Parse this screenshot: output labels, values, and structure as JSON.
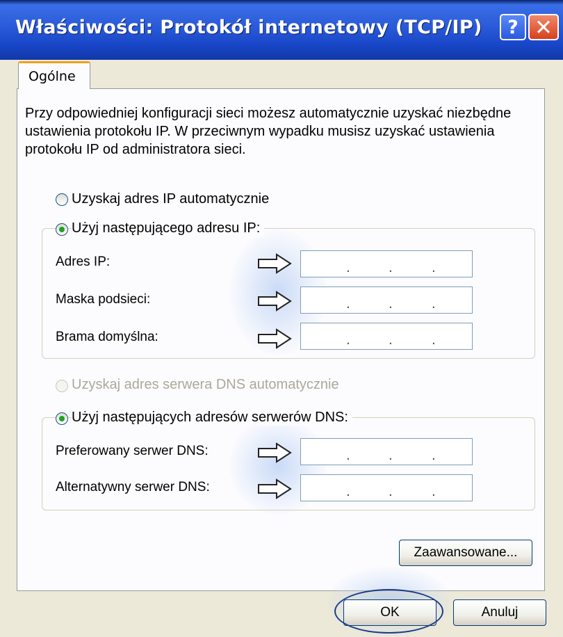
{
  "window": {
    "title": "Właściwości: Protokół internetowy (TCP/IP)",
    "help_glyph": "?",
    "close_glyph": "✕"
  },
  "tabs": [
    {
      "label": "Ogólne",
      "selected": true
    }
  ],
  "description": "Przy odpowiedniej konfiguracji sieci możesz automatycznie uzyskać niezbędne ustawienia protokołu IP. W przeciwnym wypadku musisz uzyskać ustawienia protokołu IP od administratora sieci.",
  "ip_section": {
    "auto_label": "Uzyskaj adres IP automatycznie",
    "manual_label": "Użyj następującego adresu IP:",
    "selected": "manual",
    "fields": [
      {
        "label": "Adres IP:",
        "value": ""
      },
      {
        "label": "Maska podsieci:",
        "value": ""
      },
      {
        "label": "Brama domyślna:",
        "value": ""
      }
    ]
  },
  "dns_section": {
    "auto_label": "Uzyskaj adres serwera DNS automatycznie",
    "auto_disabled": true,
    "manual_label": "Użyj następujących adresów serwerów DNS:",
    "selected": "manual",
    "fields": [
      {
        "label": "Preferowany serwer DNS:",
        "value": ""
      },
      {
        "label": "Alternatywny serwer DNS:",
        "value": ""
      }
    ]
  },
  "ip_placeholder_dot": ".",
  "buttons": {
    "advanced": "Zaawansowane...",
    "ok": "OK",
    "cancel": "Anuluj"
  },
  "annotation_icons": [
    "arrow-right-outline-icon"
  ],
  "colors": {
    "title_bar": "#2a5ad8",
    "selected_radio": "#21a121",
    "tab_accent": "#f0a21a",
    "highlight_ring": "#1a3a8a"
  }
}
